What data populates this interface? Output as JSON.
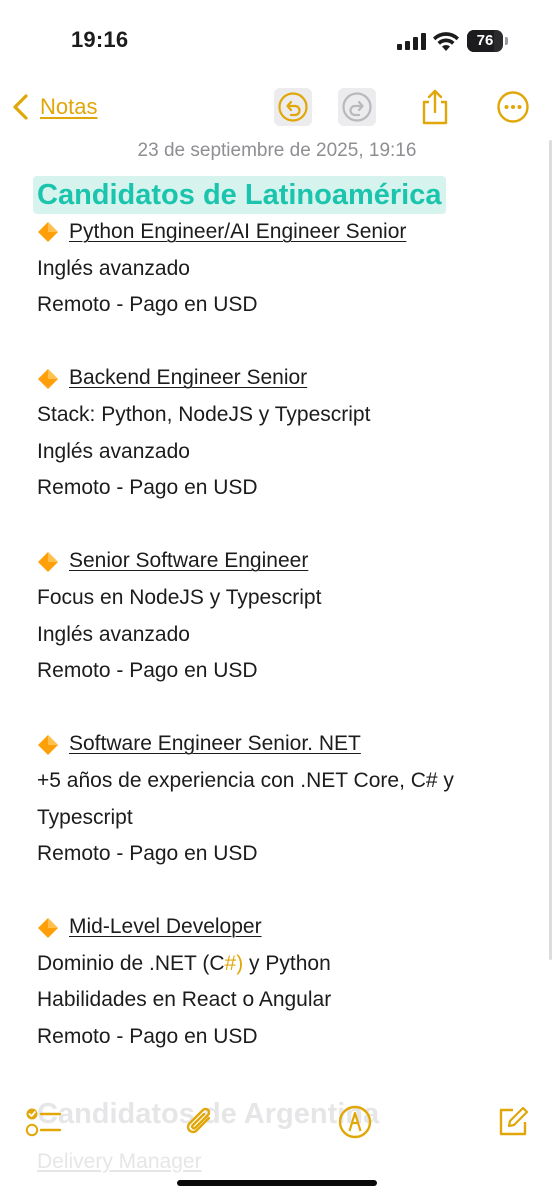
{
  "status_bar": {
    "time": "19:16",
    "battery_level": "76",
    "battery_fraction": 0.76
  },
  "nav": {
    "back_label": "Notas",
    "icons": [
      "chevron-left-icon",
      "undo-icon",
      "redo-icon",
      "share-icon",
      "more-icon"
    ]
  },
  "note": {
    "date": "23 de septiembre de 2025, 19:16",
    "title": "Candidatos de Latinoamérica",
    "sections": [
      {
        "heading": "Python Engineer/AI Engineer Senior",
        "lines": [
          "Inglés avanzado",
          "Remoto - Pago en USD"
        ]
      },
      {
        "heading": "Backend Engineer Senior",
        "lines": [
          "Stack: Python, NodeJS y Typescript",
          "Inglés avanzado",
          "Remoto - Pago en USD"
        ]
      },
      {
        "heading": "Senior Software Engineer",
        "lines": [
          "Focus en NodeJS y Typescript",
          "Inglés avanzado",
          "Remoto - Pago en USD"
        ]
      },
      {
        "heading": "Software Engineer Senior. NET",
        "lines": [
          "+5 años de experiencia con .NET Core, C# y",
          "Typescript",
          "Remoto - Pago en USD"
        ]
      },
      {
        "heading": "Mid-Level Developer",
        "lines": [
          "Dominio de .NET (C",
          "Habilidades en React o Angular",
          "Remoto - Pago en USD"
        ],
        "line1_accent": "#)",
        "line1_tail": " y Python"
      }
    ],
    "partial_next_title": "Candidatos de Argentina",
    "partial_next_heading": "Delivery Manager"
  },
  "toolbar": {
    "icons": [
      "checklist-icon",
      "attachment-icon",
      "markup-icon",
      "compose-icon"
    ]
  },
  "colors": {
    "accent": "#e1a708",
    "title_text": "#1ac4ad",
    "title_highlight": "#d6f3ee",
    "diamond": "#ff9f0a"
  }
}
